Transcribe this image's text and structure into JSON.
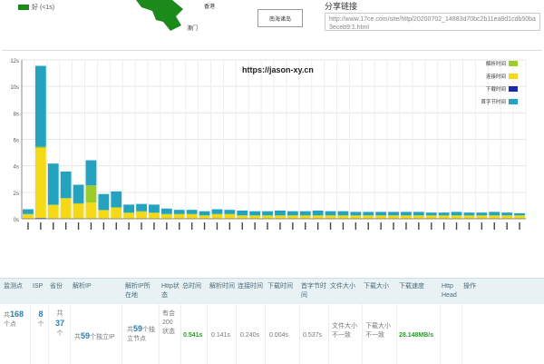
{
  "header": {
    "legend_good": "好 (<1s)",
    "map_labels": [
      "香港",
      "澳门"
    ],
    "sea_label": "南海诸岛",
    "share_title": "分享链接",
    "share_url": "http://www.17ce.com/site/http/20200702_14883d70bc2b11ea8d1cdb50ba3eceb9:1.html"
  },
  "chart_data": {
    "type": "bar",
    "stacked": true,
    "watermark": "https://jason-xy.cn",
    "y_ticks": [
      "0s",
      "2s",
      "4s",
      "6s",
      "8s",
      "10s",
      "12s"
    ],
    "ylim": [
      0,
      12
    ],
    "legend_position": "top-right",
    "series": [
      {
        "name": "解析时间",
        "color": "#9ccc2a",
        "values": [
          0.05,
          0.1,
          0.05,
          0.05,
          0.05,
          1.3,
          0.05,
          0.05,
          0.05,
          0.05,
          0.05,
          0.05,
          0.05,
          0.05,
          0.05,
          0.05,
          0.05,
          0.05,
          0.05,
          0.05,
          0.05,
          0.05,
          0.05,
          0.05,
          0.05,
          0.05,
          0.05,
          0.05,
          0.05,
          0.05,
          0.05,
          0.05,
          0.05,
          0.05,
          0.05,
          0.05,
          0.05,
          0.05,
          0.05,
          0.05
        ]
      },
      {
        "name": "连接时间",
        "color": "#f5d816",
        "values": [
          0.3,
          5.3,
          1.0,
          1.5,
          1.1,
          1.2,
          0.6,
          0.8,
          0.4,
          0.5,
          0.4,
          0.3,
          0.3,
          0.3,
          0.2,
          0.3,
          0.3,
          0.2,
          0.2,
          0.2,
          0.2,
          0.2,
          0.2,
          0.2,
          0.2,
          0.2,
          0.2,
          0.2,
          0.2,
          0.2,
          0.2,
          0.2,
          0.2,
          0.2,
          0.2,
          0.2,
          0.2,
          0.2,
          0.2,
          0.2
        ]
      },
      {
        "name": "下载时间",
        "color": "#1a2aa8",
        "values": [
          0.02,
          0.05,
          0.02,
          0.02,
          0.02,
          0.02,
          0.02,
          0.02,
          0.02,
          0.02,
          0.02,
          0.02,
          0.02,
          0.02,
          0.02,
          0.02,
          0.02,
          0.02,
          0.02,
          0.02,
          0.02,
          0.02,
          0.02,
          0.02,
          0.02,
          0.02,
          0.02,
          0.02,
          0.02,
          0.02,
          0.02,
          0.02,
          0.02,
          0.02,
          0.02,
          0.02,
          0.02,
          0.02,
          0.02,
          0.02
        ]
      },
      {
        "name": "首字节时间",
        "color": "#23a3c0",
        "values": [
          0.35,
          6.1,
          3.1,
          2.0,
          1.4,
          1.9,
          1.2,
          1.2,
          0.6,
          0.55,
          0.6,
          0.4,
          0.3,
          0.3,
          0.3,
          0.35,
          0.3,
          0.35,
          0.3,
          0.3,
          0.35,
          0.3,
          0.3,
          0.35,
          0.3,
          0.3,
          0.25,
          0.25,
          0.25,
          0.25,
          0.25,
          0.25,
          0.2,
          0.2,
          0.25,
          0.2,
          0.2,
          0.25,
          0.2,
          0.15
        ]
      }
    ]
  },
  "table": {
    "headers": [
      "监测点",
      "ISP",
      "省份",
      "解析IP",
      "解析IP所在地",
      "Http状态",
      "总时间",
      "解析时间",
      "连接时间",
      "下载时间",
      "首字节时间",
      "文件大小",
      "下载大小",
      "下载速度",
      "Http Head",
      "操作"
    ],
    "monitor_prefix": "共",
    "monitor_count": "168",
    "monitor_suffix": "个点",
    "isp_count": "8",
    "isp_suffix": "个",
    "province_prefix": "共",
    "province_count": "37",
    "province_suffix": "个",
    "ip_prefix": "共",
    "ip_count": "59",
    "ip_suffix": "个独立IP",
    "loc_prefix": "共",
    "loc_count": "59",
    "loc_suffix": "个独立节点",
    "http_status": "有会200状态",
    "total_time": "0.541s",
    "resolve_time": "0.141s",
    "connect_time": "0.240s",
    "download_time": "0.004s",
    "first_byte_time": "0.537s",
    "file_size": "文件大小不一致",
    "download_size": "下载大小不一致",
    "download_speed": "28.148MB/s"
  }
}
